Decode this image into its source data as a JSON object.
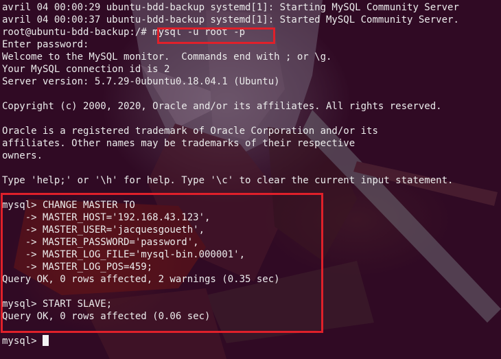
{
  "terminal": {
    "lines": [
      "avril 04 00:00:29 ubuntu-bdd-backup systemd[1]: Starting MySQL Community Server",
      "avril 04 00:00:37 ubuntu-bdd-backup systemd[1]: Started MySQL Community Server.",
      "root@ubuntu-bdd-backup:/# mysql -u root -p",
      "Enter password:",
      "Welcome to the MySQL monitor.  Commands end with ; or \\g.",
      "Your MySQL connection id is 2",
      "Server version: 5.7.29-0ubuntu0.18.04.1 (Ubuntu)",
      "",
      "Copyright (c) 2000, 2020, Oracle and/or its affiliates. All rights reserved.",
      "",
      "Oracle is a registered trademark of Oracle Corporation and/or its",
      "affiliates. Other names may be trademarks of their respective",
      "owners.",
      "",
      "Type 'help;' or '\\h' for help. Type '\\c' to clear the current input statement.",
      "",
      "mysql> CHANGE MASTER TO",
      "    -> MASTER_HOST='192.168.43.123',",
      "    -> MASTER_USER='jacquesgoueth',",
      "    -> MASTER_PASSWORD='password',",
      "    -> MASTER_LOG_FILE='mysql-bin.000001',",
      "    -> MASTER_LOG_POS=459;",
      "Query OK, 0 rows affected, 2 warnings (0.35 sec)",
      "",
      "mysql> START SLAVE;",
      "Query OK, 0 rows affected (0.06 sec)",
      "",
      "mysql> "
    ]
  },
  "colors": {
    "background": "#300a24",
    "text": "#ececec",
    "highlight_border": "#e0202a"
  }
}
